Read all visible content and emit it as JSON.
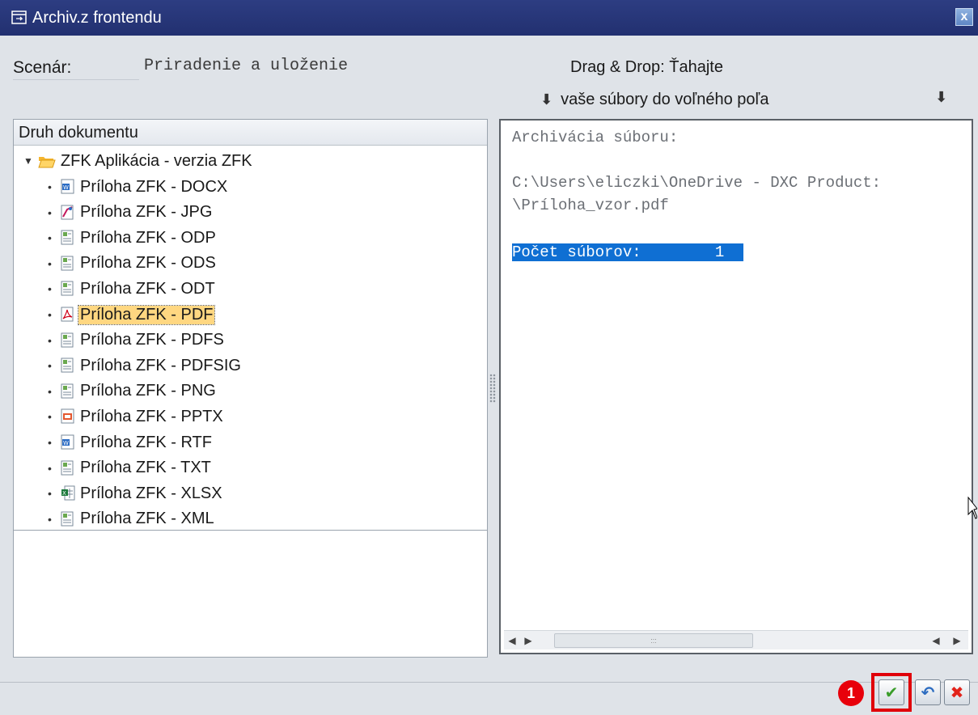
{
  "window": {
    "title": "Archiv.z frontendu",
    "close_glyph": "x"
  },
  "scenario": {
    "label": "Scenár:",
    "value": "Priradenie a uloženie"
  },
  "drag_drop": {
    "line1": "Drag & Drop: Ťahajte",
    "line2": "vaše súbory do voľného poľa"
  },
  "tree": {
    "header": "Druh dokumentu",
    "root": "ZFK Aplikácia - verzia ZFK",
    "items": [
      {
        "label": "Príloha ZFK - DOCX",
        "icon": "word-doc-icon"
      },
      {
        "label": "Príloha ZFK - JPG",
        "icon": "image-doc-icon"
      },
      {
        "label": "Príloha ZFK - ODP",
        "icon": "generic-doc-icon"
      },
      {
        "label": "Príloha ZFK - ODS",
        "icon": "generic-doc-icon"
      },
      {
        "label": "Príloha ZFK - ODT",
        "icon": "generic-doc-icon"
      },
      {
        "label": "Príloha ZFK - PDF",
        "icon": "pdf-doc-icon",
        "selected": true
      },
      {
        "label": "Príloha ZFK - PDFS",
        "icon": "generic-doc-icon"
      },
      {
        "label": "Príloha ZFK - PDFSIG",
        "icon": "generic-doc-icon"
      },
      {
        "label": "Príloha ZFK - PNG",
        "icon": "generic-doc-icon"
      },
      {
        "label": "Príloha ZFK - PPTX",
        "icon": "powerpoint-doc-icon"
      },
      {
        "label": "Príloha ZFK - RTF",
        "icon": "word-doc-icon"
      },
      {
        "label": "Príloha ZFK - TXT",
        "icon": "generic-doc-icon"
      },
      {
        "label": "Príloha ZFK - XLSX",
        "icon": "excel-doc-icon"
      },
      {
        "label": "Príloha ZFK - XML",
        "icon": "generic-doc-icon"
      }
    ]
  },
  "log": {
    "line1": "Archivácia súboru:",
    "line2": "C:\\Users\\eliczki\\OneDrive - DXC Product:",
    "line3": "\\Príloha_vzor.pdf",
    "count_line": "Počet súborov:        1"
  },
  "footer": {
    "step_badge": "1",
    "ok_glyph": "✔",
    "undo_glyph": "↶",
    "cancel_glyph": "✖"
  },
  "colors": {
    "titlebar": "#223070",
    "selection": "#ffd781",
    "highlight": "#0f6fd3",
    "callout": "#e0000a"
  }
}
